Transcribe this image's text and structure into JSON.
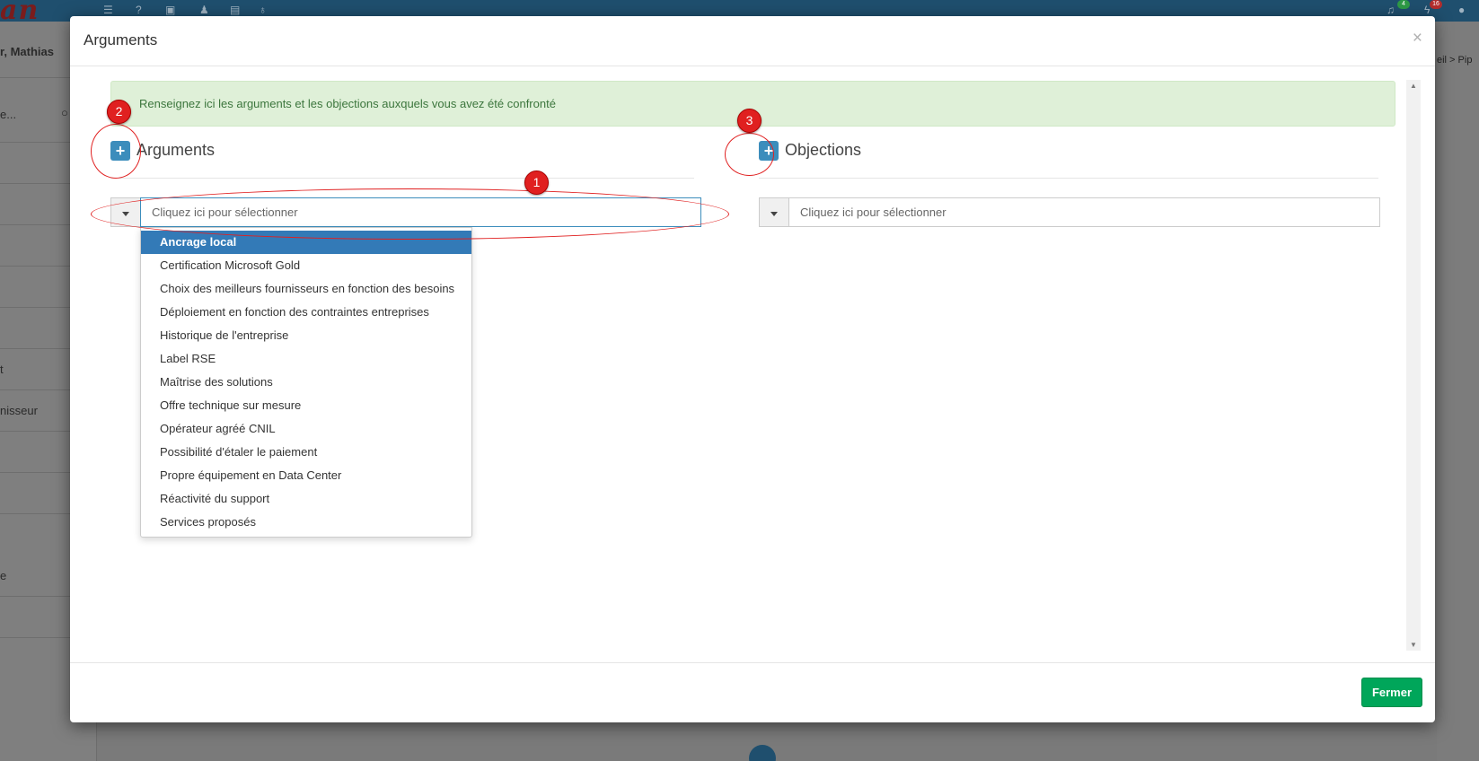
{
  "background": {
    "user_name_fragment": "r, Mathias",
    "search_fragment": "e...",
    "sidebar_fragments": [
      "t",
      "nisseur",
      "e"
    ],
    "breadcrumb_fragment": "eil  >  Pip",
    "notification_counts": [
      "4",
      "16"
    ]
  },
  "modal": {
    "title": "Arguments",
    "close_label": "×",
    "alert_text": "Renseignez ici les arguments et les objections auxquels vous avez été confronté",
    "arguments": {
      "add_label": "+",
      "title": "Arguments",
      "select_placeholder": "Cliquez ici pour sélectionner"
    },
    "objections": {
      "add_label": "+",
      "title": "Objections",
      "select_placeholder": "Cliquez ici pour sélectionner"
    },
    "dropdown_options": [
      "Ancrage local",
      "Certification Microsoft Gold",
      "Choix des meilleurs fournisseurs en fonction des besoins",
      "Déploiement en fonction des contraintes entreprises",
      "Historique de l'entreprise",
      "Label RSE",
      "Maîtrise des solutions",
      "Offre technique sur mesure",
      "Opérateur agréé CNIL",
      "Possibilité d'étaler le paiement",
      "Propre équipement en Data Center",
      "Réactivité du support",
      "Services proposés"
    ],
    "dropdown_selected": "Ancrage local",
    "footer_button": "Fermer"
  },
  "annotations": [
    "1",
    "2",
    "3"
  ],
  "colors": {
    "primary": "#3c8dbc",
    "success": "#00a65a",
    "alert_bg": "#dff0d8",
    "alert_text": "#3c763d",
    "highlight": "#337ab7",
    "annotation": "#e02020"
  }
}
